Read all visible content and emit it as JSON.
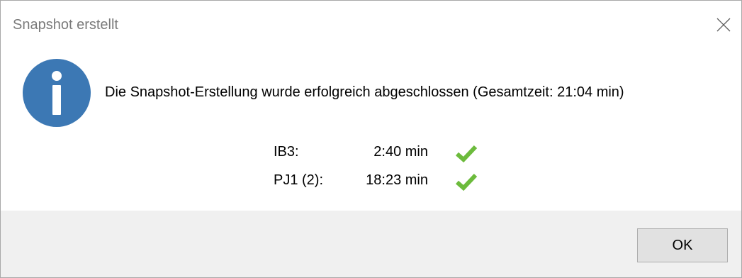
{
  "dialog": {
    "title": "Snapshot erstellt",
    "close_icon": "close-icon",
    "icon": "info-icon",
    "message": "Die Snapshot-Erstellung wurde erfolgreich abgeschlossen (Gesamtzeit: 21:04 min)",
    "results": [
      {
        "name": "IB3:",
        "time": "2:40 min",
        "status": "success",
        "icon": "checkmark-icon"
      },
      {
        "name": "PJ1 (2):",
        "time": "18:23 min",
        "status": "success",
        "icon": "checkmark-icon"
      }
    ],
    "ok_label": "OK"
  },
  "colors": {
    "info_icon_bg": "#3c78b4",
    "check_green": "#6cbb3c",
    "footer_bg": "#f0f0f0",
    "button_bg": "#e1e1e1",
    "button_border": "#adadad",
    "title_text": "#7a7a7a"
  }
}
